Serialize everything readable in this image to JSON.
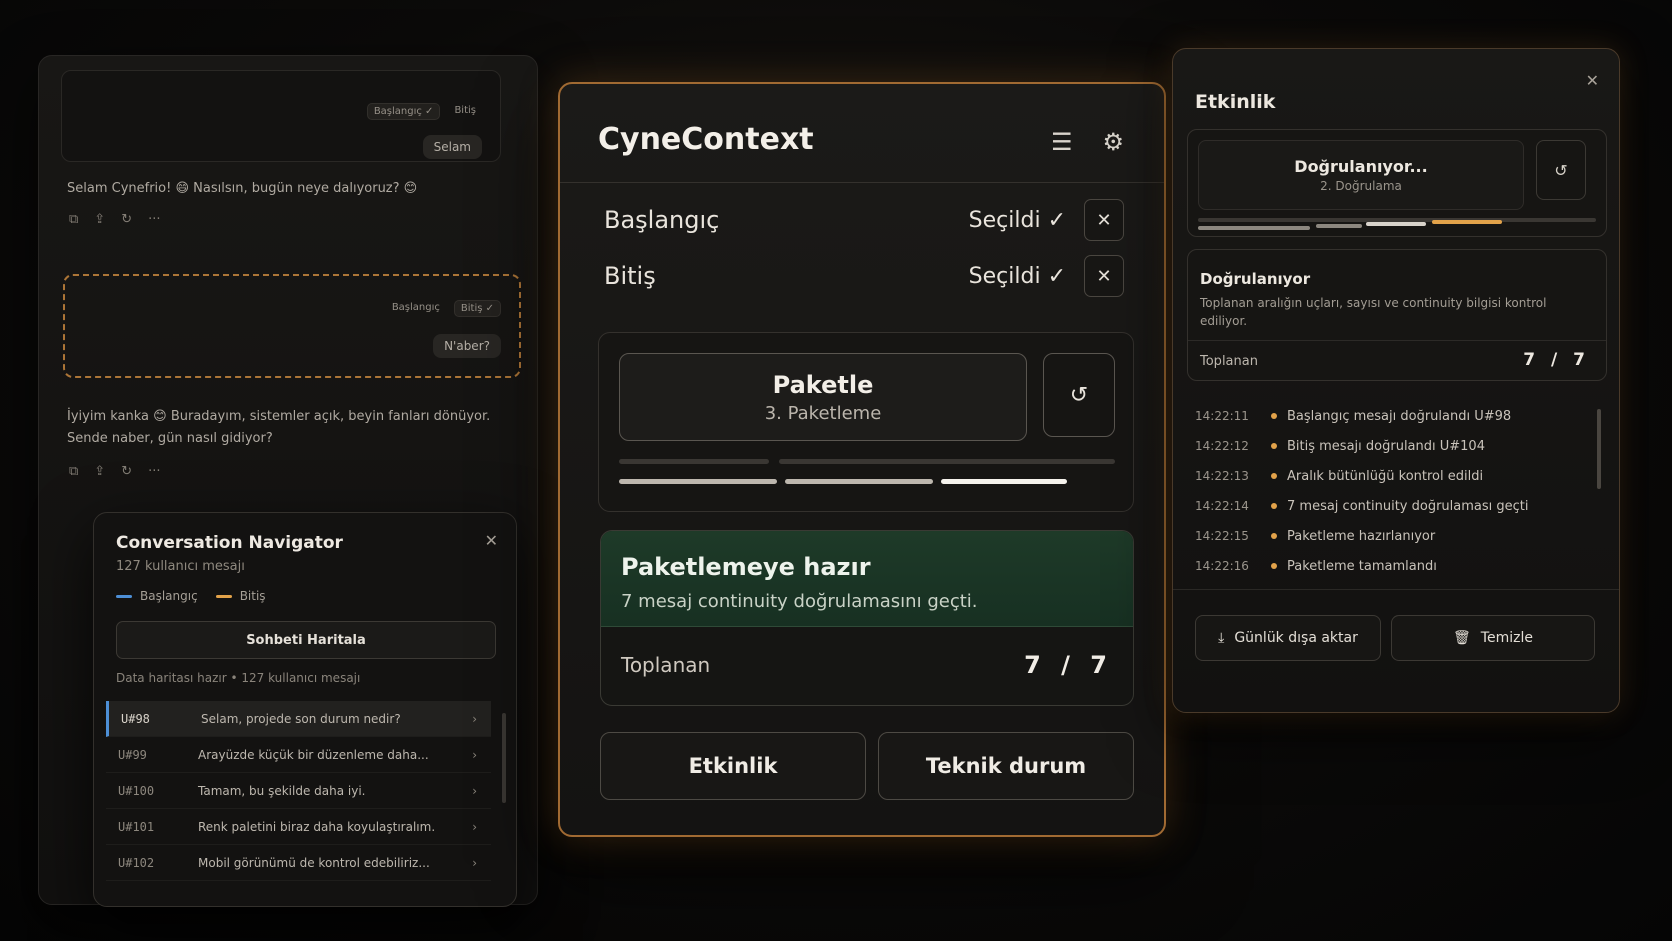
{
  "chat": {
    "msg1_tags": [
      "Başlangıç ✓",
      "Bitiş"
    ],
    "msg1_bubble": "Selam",
    "reply1": "Selam Cynefrio! 😄 Nasılsın, bugün neye dalıyoruz? 😊",
    "msg2_tags": [
      "Başlangıç",
      "Bitiş ✓"
    ],
    "msg2_bubble": "N'aber?",
    "reply2_line1": "İyiyim kanka 😊 Buradayım, sistemler açık, beyin fanları dönüyor.",
    "reply2_line2": "Sende naber, gün nasıl gidiyor?",
    "tool_icons": [
      "⧉",
      "⇪",
      "↻",
      "···"
    ]
  },
  "navigator": {
    "title": "Conversation Navigator",
    "subtitle": "127 kullanıcı mesajı",
    "legend_start": "Başlangıç",
    "legend_end": "Bitiş",
    "colors": {
      "start": "#4d8fd6",
      "end": "#e2a24a"
    },
    "map_button": "Sohbeti Haritala",
    "status": "Data haritası hazır  •  127 kullanıcı mesajı",
    "rows": [
      {
        "id": "U#98",
        "text": "Selam, projede son durum nedir?"
      },
      {
        "id": "U#99",
        "text": "Arayüzde küçük bir düzenleme daha..."
      },
      {
        "id": "U#100",
        "text": "Tamam, bu şekilde daha iyi."
      },
      {
        "id": "U#101",
        "text": "Renk paletini biraz daha koyulaştıralım."
      },
      {
        "id": "U#102",
        "text": "Mobil görünümü de kontrol edebiliriz..."
      }
    ]
  },
  "main": {
    "title": "CyneContext",
    "menu_icon": "☰",
    "settings_icon": "⚙",
    "start_label": "Başlangıç",
    "start_status": "Seçildi ✓",
    "end_label": "Bitiş",
    "end_status": "Seçildi ✓",
    "clear_icon": "✕",
    "pack_title": "Paketle",
    "pack_step": "3. Paketleme",
    "refresh_icon": "↺",
    "ready_title": "Paketlemeye hazır",
    "ready_desc": "7 mesaj continuity doğrulamasını geçti.",
    "collected_label": "Toplanan",
    "collected_value": "7 / 7",
    "btn_activity": "Etkinlik",
    "btn_tech": "Teknik durum"
  },
  "activity": {
    "title": "Etkinlik",
    "close_icon": "✕",
    "step_title": "Doğrulanıyor...",
    "step_sub": "2. Doğrulama",
    "verify_title": "Doğrulanıyor",
    "verify_desc": "Toplanan aralığın uçları, sayısı ve continuity bilgisi kontrol ediliyor.",
    "collected_label": "Toplanan",
    "collected_value": "7 / 7",
    "log": [
      {
        "time": "14:22:11",
        "text": "Başlangıç mesajı doğrulandı U#98"
      },
      {
        "time": "14:22:12",
        "text": "Bitiş mesajı doğrulandı U#104"
      },
      {
        "time": "14:22:13",
        "text": "Aralık bütünlüğü kontrol edildi"
      },
      {
        "time": "14:22:14",
        "text": "7 mesaj continuity doğrulaması geçti"
      },
      {
        "time": "14:22:15",
        "text": "Paketleme hazırlanıyor"
      },
      {
        "time": "14:22:16",
        "text": "Paketleme tamamlandı"
      }
    ],
    "export_icon": "⤓",
    "export_label": "Günlük dışa aktar",
    "trash_icon": "🗑",
    "clear_label": "Temizle"
  }
}
